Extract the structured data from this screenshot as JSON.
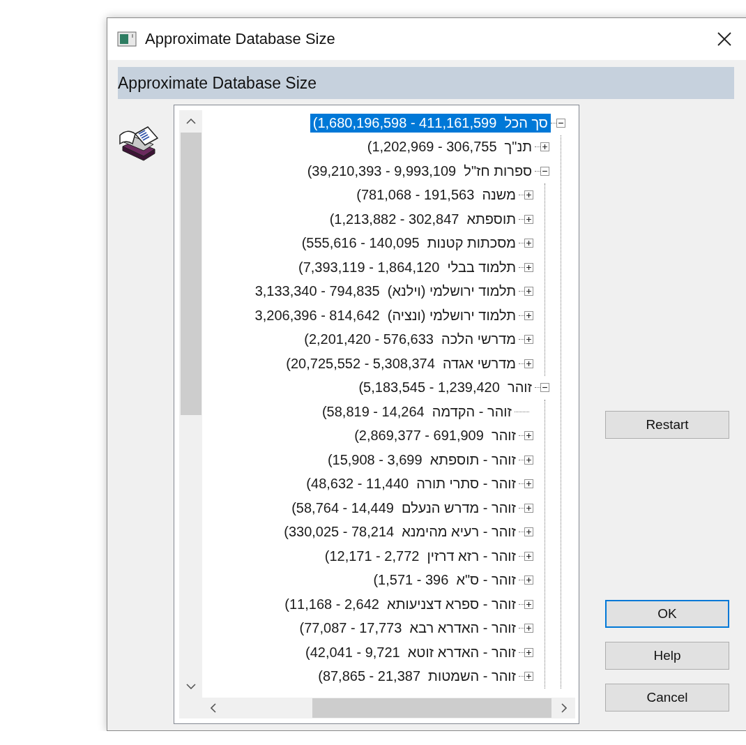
{
  "window": {
    "title": "Approximate Database Size"
  },
  "header": "Approximate Database Size",
  "tree": [
    {
      "label": "סך הכל  411,161,599 - 1,680,196,598)",
      "kind": "expanded",
      "selected": true,
      "children": [
        {
          "label": "תנ\"ך  306,755 - 1,202,969)",
          "kind": "collapsed",
          "selected": false
        },
        {
          "label": "ספרות חז\"ל  9,993,109 - 39,210,393)",
          "kind": "expanded",
          "selected": false,
          "children": [
            {
              "label": "משנה  191,563 - 781,068)",
              "kind": "collapsed",
              "selected": false
            },
            {
              "label": "תוספתא  302,847 - 1,213,882)",
              "kind": "collapsed",
              "selected": false
            },
            {
              "label": "מסכתות קטנות  140,095 - 555,616)",
              "kind": "collapsed",
              "selected": false
            },
            {
              "label": "תלמוד בבלי  1,864,120 - 7,393,119)",
              "kind": "collapsed",
              "selected": false
            },
            {
              "label": "תלמוד ירושלמי (וילנא)  794,835 - 3,133,340",
              "kind": "collapsed",
              "selected": false
            },
            {
              "label": "תלמוד ירושלמי (ונציה)  814,642 - 3,206,396",
              "kind": "collapsed",
              "selected": false
            },
            {
              "label": "מדרשי הלכה  576,633 - 2,201,420)",
              "kind": "collapsed",
              "selected": false
            },
            {
              "label": "מדרשי אגדה  5,308,374 - 20,725,552)",
              "kind": "collapsed",
              "selected": false
            }
          ]
        },
        {
          "label": "זוהר  1,239,420 - 5,183,545)",
          "kind": "expanded",
          "selected": false,
          "children": [
            {
              "label": "זוהר - הקדמה  14,264 - 58,819)",
              "kind": "leaf",
              "selected": false
            },
            {
              "label": "זוהר  691,909 - 2,869,377)",
              "kind": "collapsed",
              "selected": false
            },
            {
              "label": "זוהר - תוספתא  3,699 - 15,908)",
              "kind": "collapsed",
              "selected": false
            },
            {
              "label": "זוהר - סתרי תורה  11,440 - 48,632)",
              "kind": "collapsed",
              "selected": false
            },
            {
              "label": "זוהר - מדרש הנעלם  14,449 - 58,764)",
              "kind": "collapsed",
              "selected": false
            },
            {
              "label": "זוהר - רעיא מהימנא  78,214 - 330,025)",
              "kind": "collapsed",
              "selected": false
            },
            {
              "label": "זוהר - רזא דרזין  2,772 - 12,171)",
              "kind": "collapsed",
              "selected": false
            },
            {
              "label": "זוהר - ס\"א  396 - 1,571)",
              "kind": "collapsed",
              "selected": false
            },
            {
              "label": "זוהר - ספרא דצניעותא  2,642 - 11,168)",
              "kind": "collapsed",
              "selected": false
            },
            {
              "label": "זוהר - האדרא רבא  17,773 - 77,087)",
              "kind": "collapsed",
              "selected": false
            },
            {
              "label": "זוהר - האדרא זוטא  9,721 - 42,041)",
              "kind": "collapsed",
              "selected": false
            },
            {
              "label": "זוהר - השמטות  21,387 - 87,865)",
              "kind": "collapsed",
              "selected": false
            }
          ]
        }
      ]
    }
  ],
  "side_buttons": [
    {
      "label": "Restart",
      "default": false
    }
  ],
  "buttons": [
    {
      "label": "OK",
      "default": true
    },
    {
      "label": "Help",
      "default": false
    },
    {
      "label": "Cancel",
      "default": false
    }
  ]
}
